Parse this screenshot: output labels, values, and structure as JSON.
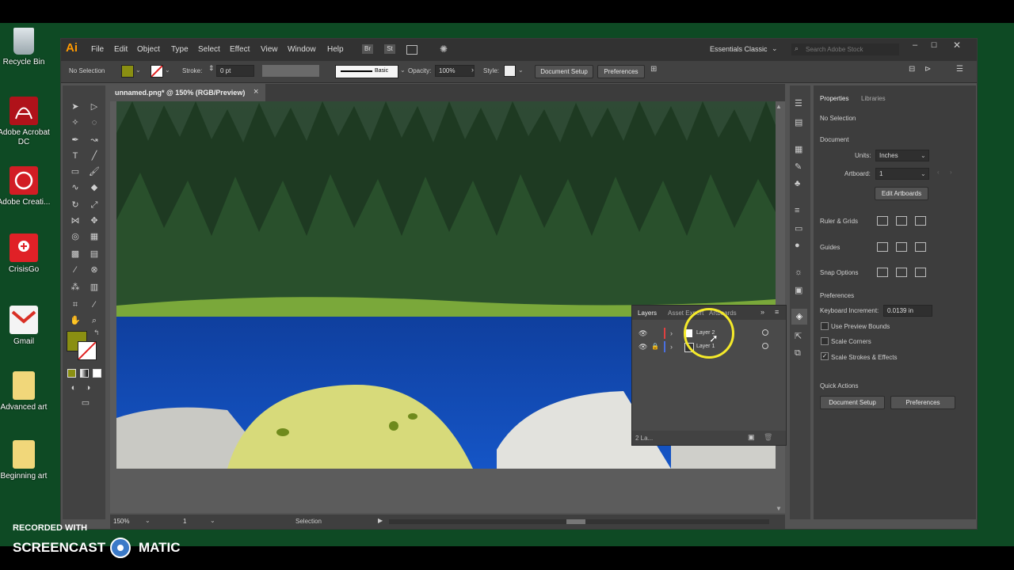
{
  "desktop": {
    "icons": [
      {
        "name": "recycle-bin",
        "label": "Recycle Bin"
      },
      {
        "name": "adobe-acrobat",
        "label": "Adobe Acrobat DC"
      },
      {
        "name": "adobe-creative-cloud",
        "label": "Adobe Creati..."
      },
      {
        "name": "crisisgo",
        "label": "CrisisGo"
      },
      {
        "name": "gmail",
        "label": "Gmail"
      },
      {
        "name": "advanced-art-folder",
        "label": "Advanced art"
      },
      {
        "name": "beginning-art-folder",
        "label": "Beginning art"
      }
    ]
  },
  "app": {
    "logo": "Ai",
    "menu": [
      "File",
      "Edit",
      "Object",
      "Type",
      "Select",
      "Effect",
      "View",
      "Window",
      "Help"
    ],
    "bridge": "Br",
    "stock": "St",
    "workspace": "Essentials Classic",
    "search_placeholder": "Search Adobe Stock"
  },
  "control_bar": {
    "selection": "No Selection",
    "stroke_label": "Stroke:",
    "stroke_value": "0 pt",
    "brush": "Basic",
    "opacity_label": "Opacity:",
    "opacity_value": "100%",
    "style_label": "Style:",
    "document_setup": "Document Setup",
    "preferences": "Preferences"
  },
  "tab": {
    "title": "unnamed.png* @ 150% (RGB/Preview)",
    "close": "×"
  },
  "status_bar": {
    "zoom": "150%",
    "artboard": "1",
    "tool": "Selection"
  },
  "layers_panel": {
    "tabs": [
      "Layers",
      "Asset Export",
      "Artboards"
    ],
    "layers": [
      {
        "name": "Layer 2",
        "color": "#e04040"
      },
      {
        "name": "Layer 1",
        "color": "#4a6fe0"
      }
    ],
    "count": "2 La..."
  },
  "properties": {
    "tabs": [
      "Properties",
      "Libraries"
    ],
    "no_selection": "No Selection",
    "document_heading": "Document",
    "units_label": "Units:",
    "units_value": "Inches",
    "artboard_label": "Artboard:",
    "artboard_value": "1",
    "edit_artboards": "Edit Artboards",
    "ruler_grids": "Ruler & Grids",
    "guides": "Guides",
    "snap_options": "Snap Options",
    "preferences_heading": "Preferences",
    "keyboard_increment_label": "Keyboard Increment:",
    "keyboard_increment_value": "0.0139 in",
    "use_preview_bounds": "Use Preview Bounds",
    "scale_corners": "Scale Corners",
    "scale_strokes": "Scale Strokes & Effects",
    "quick_actions": "Quick Actions",
    "qa_document_setup": "Document Setup",
    "qa_preferences": "Preferences"
  },
  "watermark": {
    "recorded": "RECORDED WITH",
    "brand_left": "SCREENCAST",
    "brand_right": "MATIC"
  },
  "colors": {
    "fill": "#8a8f12",
    "accent": "#3b7ac8"
  }
}
